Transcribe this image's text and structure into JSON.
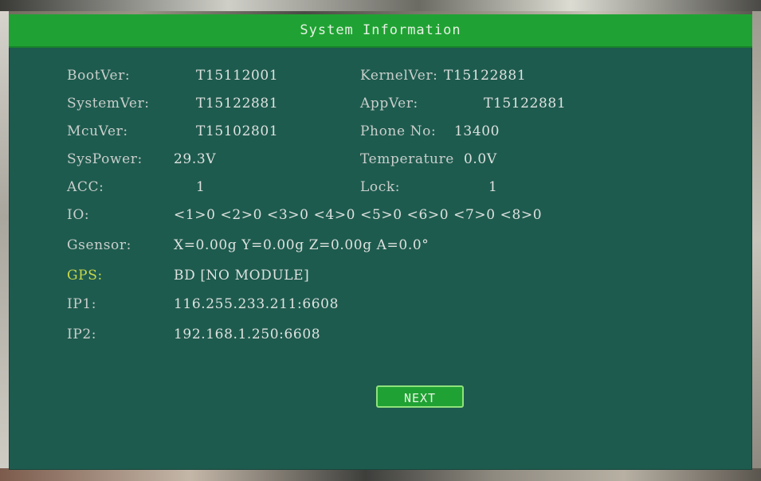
{
  "window": {
    "title": "System Information"
  },
  "info": {
    "boot_label": "BootVer:",
    "boot_value": "T15112001",
    "kernel_label": "KernelVer:",
    "kernel_value": "T15122881",
    "system_label": "SystemVer:",
    "system_value": "T15122881",
    "app_label": "AppVer:",
    "app_value": "T15122881",
    "mcu_label": "McuVer:",
    "mcu_value": "T15102801",
    "phone_label": "Phone No:",
    "phone_value": "13400",
    "syspower_label": "SysPower:",
    "syspower_value": "29.3V",
    "temperature_label": "Temperature",
    "temperature_value": "0.0V",
    "acc_label": "ACC:",
    "acc_value": "1",
    "lock_label": "Lock:",
    "lock_value": "1",
    "io_label": "IO:",
    "io_value": "<1>0 <2>0 <3>0 <4>0 <5>0 <6>0 <7>0 <8>0",
    "gsensor_label": "Gsensor:",
    "gsensor_value": "X=0.00g Y=0.00g Z=0.00g A=0.0°",
    "gps_label": "GPS:",
    "gps_value": "BD [NO MODULE]",
    "ip1_label": "IP1:",
    "ip1_value": "116.255.233.211:6608",
    "ip2_label": "IP2:",
    "ip2_value": "192.168.1.250:6608"
  },
  "buttons": {
    "next_label": "NEXT"
  },
  "colors": {
    "panel_bg": "#1e5b4f",
    "title_bar": "#1fa233",
    "gps_label": "#c8d84a",
    "text": "#d7dcd8"
  }
}
